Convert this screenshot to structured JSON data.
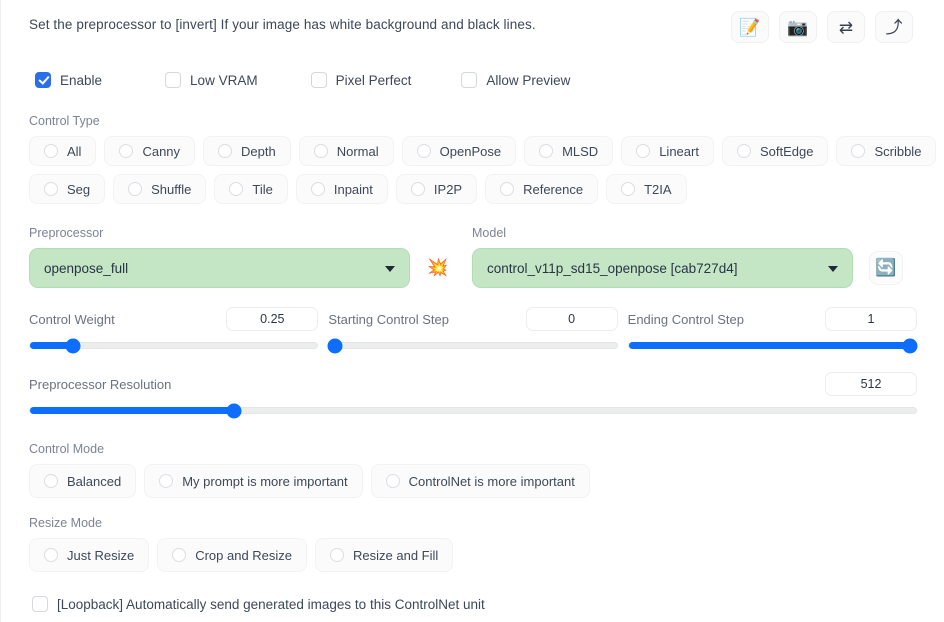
{
  "header": {
    "hint": "Set the preprocessor to [invert] If your image has white background and black lines.",
    "icons": [
      {
        "name": "edit-memo-icon",
        "glyph": "📝"
      },
      {
        "name": "camera-icon",
        "glyph": "📷"
      },
      {
        "name": "swap-arrows-icon",
        "glyph": "⇄"
      },
      {
        "name": "arrow-heading-up-icon",
        "glyph": "⤴"
      }
    ]
  },
  "toggles": [
    {
      "label": "Enable",
      "checked": true
    },
    {
      "label": "Low VRAM",
      "checked": false
    },
    {
      "label": "Pixel Perfect",
      "checked": false
    },
    {
      "label": "Allow Preview",
      "checked": false
    }
  ],
  "control_type": {
    "label": "Control Type",
    "row1": [
      "All",
      "Canny",
      "Depth",
      "Normal",
      "OpenPose",
      "MLSD",
      "Lineart",
      "SoftEdge",
      "Scribble"
    ],
    "row2": [
      "Seg",
      "Shuffle",
      "Tile",
      "Inpaint",
      "IP2P",
      "Reference",
      "T2IA"
    ],
    "selected": null
  },
  "preprocessor": {
    "label": "Preprocessor",
    "value": "openpose_full",
    "action_icon": "collision-icon",
    "action_glyph": "💥"
  },
  "model": {
    "label": "Model",
    "value": "control_v11p_sd15_openpose [cab727d4]",
    "refresh_icon": "refresh-icon",
    "refresh_glyph": "🔄"
  },
  "sliders": {
    "control_weight": {
      "label": "Control Weight",
      "value": "0.25",
      "percent": 15
    },
    "starting_control_step": {
      "label": "Starting Control Step",
      "value": "0",
      "percent": 0
    },
    "ending_control_step": {
      "label": "Ending Control Step",
      "value": "1",
      "percent": 100
    },
    "preprocessor_resolution": {
      "label": "Preprocessor Resolution",
      "value": "512",
      "percent": 23
    }
  },
  "control_mode": {
    "label": "Control Mode",
    "options": [
      "Balanced",
      "My prompt is more important",
      "ControlNet is more important"
    ],
    "selected": null
  },
  "resize_mode": {
    "label": "Resize Mode",
    "options": [
      "Just Resize",
      "Crop and Resize",
      "Resize and Fill"
    ],
    "selected": null
  },
  "loopback": {
    "label": "[Loopback] Automatically send generated images to this ControlNet unit",
    "checked": false
  },
  "colors": {
    "accent_blue": "#0d6efd",
    "checkbox_blue": "#2b6fe8",
    "dropdown_green": "#c5e6c5",
    "label_gray": "#7b8495",
    "text_navy": "#3d4858"
  }
}
